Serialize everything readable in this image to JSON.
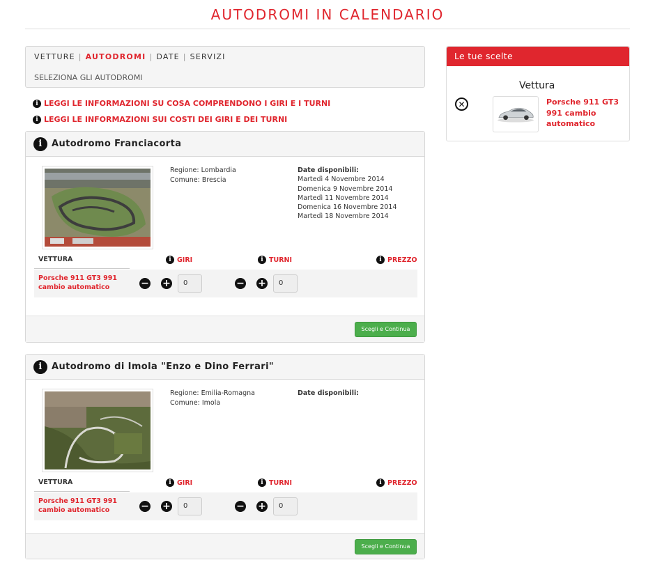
{
  "page": {
    "title": "AUTODROMI IN CALENDARIO"
  },
  "steps": {
    "items": [
      "VETTURE",
      "AUTODROMI",
      "DATE",
      "SERVIZI"
    ],
    "separator": "|",
    "active": "AUTODROMI",
    "subtitle": "SELEZIONA GLI AUTODROMI"
  },
  "info_links": [
    "LEGGI LE INFORMAZIONI SU COSA COMPRENDONO I GIRI E I TURNI",
    "LEGGI LE INFORMAZIONI SUI COSTI DEI GIRI E DEI TURNI"
  ],
  "labels": {
    "regione": "Regione:",
    "comune": "Comune:",
    "date_disponibili": "Date disponibili:",
    "vettura": "VETTURA",
    "giri": "GIRI",
    "turni": "TURNI",
    "prezzo": "PREZZO",
    "continue_button": "Scegli e Continua"
  },
  "tracks": [
    {
      "name": "Autodromo Franciacorta",
      "region": "Lombardia",
      "town": "Brescia",
      "dates": [
        "Martedì 4 Novembre 2014",
        "Domenica 9 Novembre 2014",
        "Martedì 11 Novembre 2014",
        "Domenica 16 Novembre 2014",
        "Martedì 18 Novembre 2014"
      ],
      "car": "Porsche 911 GT3 991 cambio automatico",
      "car_lines": [
        "Porsche 911 GT3 991",
        "cambio automatico"
      ],
      "giri": "0",
      "turni": "0"
    },
    {
      "name": "Autodromo di Imola \"Enzo e Dino Ferrari\"",
      "region": "Emilia-Romagna",
      "town": "Imola",
      "dates": [],
      "car": "Porsche 911 GT3 991 cambio automatico",
      "car_lines": [
        "Porsche 911 GT3 991",
        "cambio automatico"
      ],
      "giri": "0",
      "turni": "0"
    }
  ],
  "choices": {
    "header": "Le tue scelte",
    "title": "Vettura",
    "car_lines": [
      "Porsche 911 GT3",
      "991 cambio",
      "automatico"
    ]
  },
  "icons": {
    "info": "info-circle-icon",
    "minus": "minus-circle-icon",
    "plus": "plus-circle-icon",
    "remove": "remove-circle-icon"
  },
  "colors": {
    "accent": "#e0262e",
    "button": "#4cae4c",
    "panel": "#f5f5f5"
  }
}
